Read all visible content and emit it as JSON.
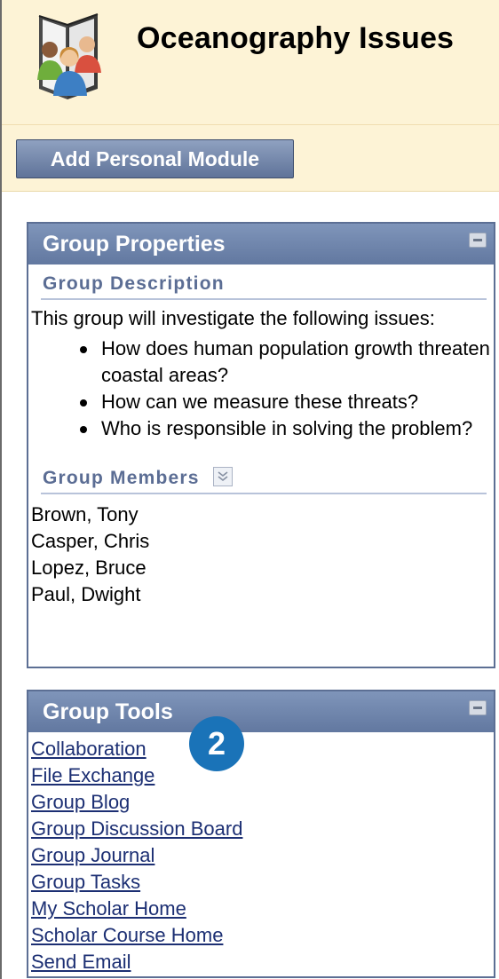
{
  "header": {
    "title": "Oceanography Issues",
    "icon": "group-people-icon",
    "add_module_label": "Add Personal Module"
  },
  "group_properties": {
    "title": "Group Properties",
    "description_heading": "Group Description",
    "description_intro": "This group will investigate the following issues:",
    "issues": [
      "How does human population growth threaten coastal areas?",
      "How can we measure these threats?",
      "Who is responsible in solving the problem?"
    ],
    "members_heading": "Group Members",
    "members": [
      "Brown, Tony",
      "Casper, Chris",
      "Lopez, Bruce",
      "Paul, Dwight"
    ]
  },
  "group_tools": {
    "title": "Group Tools",
    "links": [
      "Collaboration",
      "File Exchange",
      "Group Blog",
      "Group Discussion Board",
      "Group Journal",
      "Group Tasks",
      "My Scholar Home",
      "Scholar Course Home",
      "Send Email"
    ]
  },
  "callout_badge": "2",
  "colors": {
    "header_bg": "#fdf3d6",
    "panel_header": "#6f84ab",
    "link": "#1c2f73",
    "badge": "#1a73b8"
  }
}
